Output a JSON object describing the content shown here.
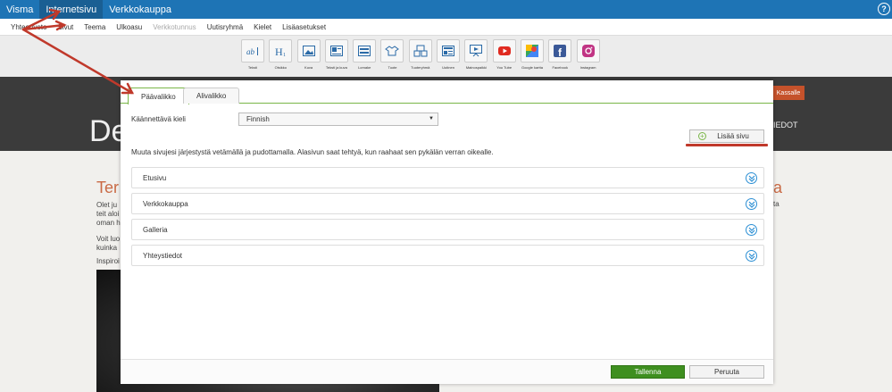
{
  "topbar": {
    "items": [
      "Visma",
      "Internetsivu",
      "Verkkokauppa"
    ],
    "help_label": "?"
  },
  "menubar": {
    "items": [
      "Yhteenveto",
      "Sivut",
      "Teema",
      "Ulkoasu",
      "Verkkotunnus",
      "Uutisryhmä",
      "Kielet",
      "Lisäasetukset"
    ]
  },
  "toolbar": {
    "widgets": [
      {
        "label": "Teksti",
        "icon": "text-icon"
      },
      {
        "label": "Otsikko",
        "icon": "heading-icon"
      },
      {
        "label": "Kuva",
        "icon": "image-icon"
      },
      {
        "label": "Teksti ja kuva",
        "icon": "text-image-icon"
      },
      {
        "label": "Lomake",
        "icon": "form-icon"
      },
      {
        "label": "Tuote",
        "icon": "product-icon"
      },
      {
        "label": "Tuoteryhmä",
        "icon": "product-group-icon"
      },
      {
        "label": "Uutinen",
        "icon": "news-icon"
      },
      {
        "label": "Mainospaikki",
        "icon": "ad-icon"
      },
      {
        "label": "You Tube",
        "icon": "youtube-icon"
      },
      {
        "label": "Google kartta",
        "icon": "google-maps-icon"
      },
      {
        "label": "Facebook",
        "icon": "facebook-icon"
      },
      {
        "label": "Instagram",
        "icon": "instagram-icon"
      }
    ]
  },
  "background": {
    "hero": "De",
    "kassa": "Kassalle",
    "nav": "IEDOT",
    "heading": "Ter",
    "heading_right": "a",
    "lines": [
      "Olet ju",
      "teit aloi",
      "oman h",
      "Voit luo",
      "kuinka",
      "Inspiroi"
    ],
    "text_right": "ta"
  },
  "modal": {
    "tabs": [
      "Päävalikko",
      "Alivalikko"
    ],
    "language_label": "Käännettävä kieli",
    "language_value": "Finnish",
    "add_page_label": "Lisää sivu",
    "instructions": "Muuta sivujesi järjestystä vetämällä ja pudottamalla. Alasivun saat tehtyä, kun raahaat sen pykälän verran oikealle.",
    "pages": [
      "Etusivu",
      "Verkkokauppa",
      "Galleria",
      "Yhteystiedot"
    ],
    "save_label": "Tallenna",
    "cancel_label": "Peruuta"
  },
  "colors": {
    "topbar": "#1e74b5",
    "accent_green": "#7ab648",
    "save_button": "#3e8f1f",
    "annotation_red": "#c0392b",
    "expand_icon": "#2c8fd4"
  }
}
